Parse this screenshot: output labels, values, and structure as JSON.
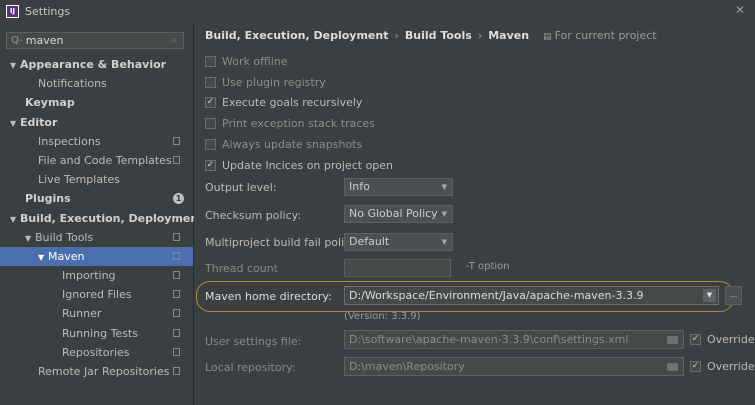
{
  "window": {
    "title": "Settings",
    "logo": "IJ"
  },
  "search": {
    "value": "maven",
    "clear": "×"
  },
  "tree": [
    {
      "label": "Appearance & Behavior",
      "indent": 10,
      "bold": true,
      "arrow": "▼"
    },
    {
      "label": "Notifications",
      "indent": 38,
      "bold": false
    },
    {
      "label": "Keymap",
      "indent": 25,
      "bold": true
    },
    {
      "label": "Editor",
      "indent": 10,
      "bold": true,
      "arrow": "▼"
    },
    {
      "label": "Inspections",
      "indent": 38,
      "bold": false,
      "copy": true
    },
    {
      "label": "File and Code Templates",
      "indent": 38,
      "bold": false,
      "copy": true
    },
    {
      "label": "Live Templates",
      "indent": 38,
      "bold": false
    },
    {
      "label": "Plugins",
      "indent": 25,
      "bold": true,
      "badge": "1"
    },
    {
      "label": "Build, Execution, Deployment",
      "indent": 10,
      "bold": true,
      "arrow": "▼"
    },
    {
      "label": "Build Tools",
      "indent": 25,
      "bold": false,
      "arrow": "▼",
      "copy": true
    },
    {
      "label": "Maven",
      "indent": 38,
      "bold": false,
      "arrow": "▼",
      "copy": true,
      "selected": true
    },
    {
      "label": "Importing",
      "indent": 62,
      "bold": false,
      "copy": true
    },
    {
      "label": "Ignored Files",
      "indent": 62,
      "bold": false,
      "copy": true
    },
    {
      "label": "Runner",
      "indent": 62,
      "bold": false,
      "copy": true
    },
    {
      "label": "Running Tests",
      "indent": 62,
      "bold": false,
      "copy": true
    },
    {
      "label": "Repositories",
      "indent": 62,
      "bold": false,
      "copy": true
    },
    {
      "label": "Remote Jar Repositories",
      "indent": 38,
      "bold": false,
      "copy": true
    }
  ],
  "breadcrumb": {
    "part1": "Build, Execution, Deployment",
    "sep": "›",
    "part2": "Build Tools",
    "part3": "Maven",
    "project": "For current project"
  },
  "checkboxes": [
    {
      "label": "Work offline",
      "checked": false
    },
    {
      "label": "Use plugin registry",
      "checked": false
    },
    {
      "label": "Execute goals recursively",
      "checked": true
    },
    {
      "label": "Print exception stack traces",
      "checked": false
    },
    {
      "label": "Always update snapshots",
      "checked": false
    },
    {
      "label": "Update Incices on project open",
      "checked": true
    }
  ],
  "fields": {
    "output_level": {
      "label": "Output level:",
      "value": "Info"
    },
    "checksum": {
      "label": "Checksum policy:",
      "value": "No Global Policy"
    },
    "multiproject": {
      "label": "Multiproject build fail policy:",
      "value": "Default"
    },
    "thread_count": {
      "label": "Thread count",
      "hint": "-T option"
    },
    "maven_home": {
      "label": "Maven home directory:",
      "value": "D:/Workspace/Environment/Java/apache-maven-3.3.9",
      "version": "(Version: 3.3.9)"
    },
    "user_settings": {
      "label": "User settings file:",
      "value": "D:\\software\\apache-maven-3.3.9\\conf\\settings.xml",
      "override": "Override"
    },
    "local_repo": {
      "label": "Local repository:",
      "value": "D:\\maven\\Repository",
      "override": "Override"
    }
  },
  "more_label": "...",
  "check_mark": "✓"
}
